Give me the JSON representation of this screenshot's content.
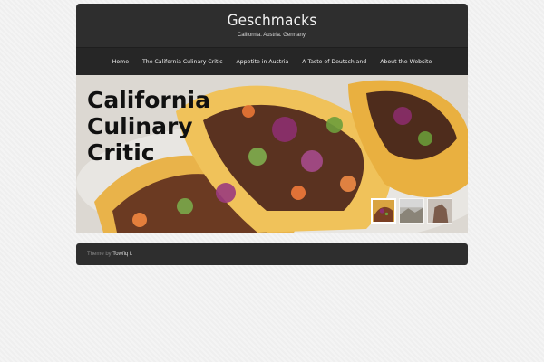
{
  "header": {
    "title": "Geschmacks",
    "tagline": "California. Austria. Germany."
  },
  "nav": {
    "items": [
      {
        "label": "Home"
      },
      {
        "label": "The California Culinary Critic"
      },
      {
        "label": "Appetite in Austria"
      },
      {
        "label": "A Taste of Deutschland"
      },
      {
        "label": "About the Website"
      }
    ]
  },
  "slider": {
    "caption_lines": [
      "California",
      "Culinary",
      "Critic"
    ],
    "thumbnails": [
      {
        "name": "tacos-thumbnail",
        "active": true
      },
      {
        "name": "landscape-thumbnail",
        "active": false
      },
      {
        "name": "rock-thumbnail",
        "active": false
      }
    ]
  },
  "footer": {
    "prefix": "Theme by",
    "author": "Towfiq I."
  }
}
